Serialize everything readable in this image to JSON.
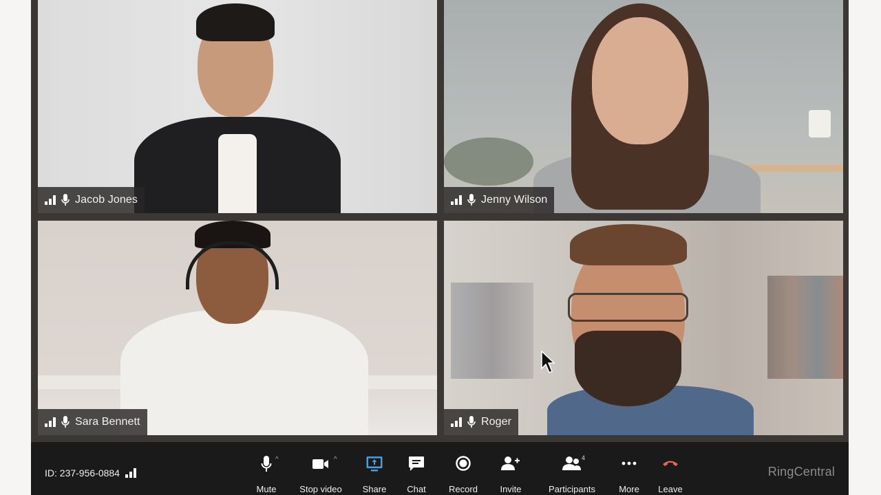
{
  "participants": [
    {
      "name": "Jacob Jones",
      "signal": "signal-bars-icon",
      "mic": "microphone-icon"
    },
    {
      "name": "Jenny Wilson",
      "signal": "signal-bars-icon",
      "mic": "microphone-icon"
    },
    {
      "name": "Sara Bennett",
      "signal": "signal-bars-icon",
      "mic": "microphone-icon"
    },
    {
      "name": "Roger",
      "signal": "signal-bars-icon",
      "mic": "microphone-icon"
    }
  ],
  "toolbar": {
    "meeting_id": "ID: 237-956-0884",
    "buttons": [
      {
        "label": "Mute",
        "icon": "microphone-icon",
        "has_caret": true
      },
      {
        "label": "Stop video",
        "icon": "video-camera-icon",
        "has_caret": true
      },
      {
        "label": "Share",
        "icon": "share-screen-icon",
        "accent": "#4a9fd8"
      },
      {
        "label": "Chat",
        "icon": "chat-bubble-icon"
      },
      {
        "label": "Record",
        "icon": "record-icon"
      },
      {
        "label": "Invite",
        "icon": "add-person-icon"
      },
      {
        "label": "Participants",
        "icon": "participants-icon",
        "badge": "4"
      },
      {
        "label": "More",
        "icon": "more-dots-icon"
      },
      {
        "label": "Leave",
        "icon": "hang-up-icon",
        "accent": "#e8664f"
      }
    ],
    "caret_glyph": "^",
    "brand": "RingCentral"
  },
  "colors": {
    "toolbar_bg": "#1b1a1a",
    "frame": "#3a3735",
    "share_accent": "#4a9fd8",
    "leave_accent": "#e8664f"
  }
}
